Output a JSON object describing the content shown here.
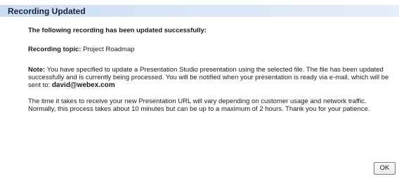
{
  "dialog": {
    "title": "Recording Updated",
    "intro": "The following recording has been updated successfully:",
    "topic_label": "Recording topic:",
    "topic_value": "Project Roadmap",
    "note_label": "Note:",
    "note_text_before": "You have specified to update a Presentation Studio presentation using the selected file. The file has been updated successfully and is currently being processed. You will be notified when your presentation is ready via e-mail, which will be sent to:",
    "email": "david@webex.com",
    "time_text": "The time it takes to receive your new Presentation URL will vary depending on customer usage and network traffic. Normally, this process takes about 10 minutes but can be up to a maximum of 2 hours. Thank you for your patience.",
    "ok_label": "OK"
  },
  "colors": {
    "titlebar_start": "#c9dcf3",
    "titlebar_end": "#e4edf9"
  }
}
